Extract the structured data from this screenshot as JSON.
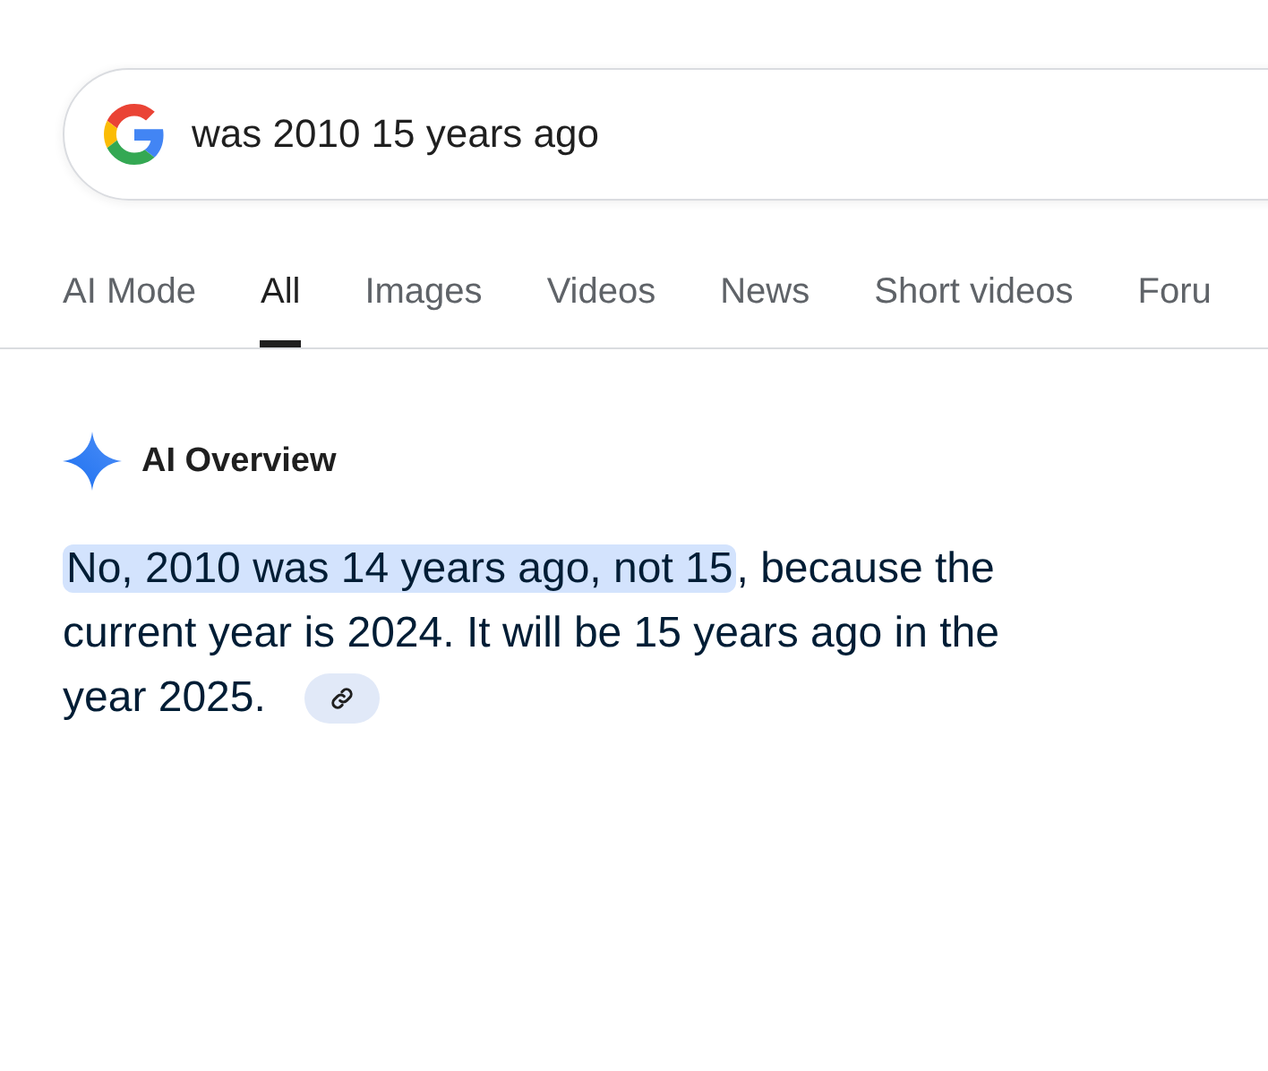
{
  "search": {
    "value": "was 2010 15 years ago"
  },
  "tabs": [
    {
      "label": "AI Mode",
      "selected": false
    },
    {
      "label": "All",
      "selected": true
    },
    {
      "label": "Images",
      "selected": false
    },
    {
      "label": "Videos",
      "selected": false
    },
    {
      "label": "News",
      "selected": false
    },
    {
      "label": "Short videos",
      "selected": false
    },
    {
      "label": "Foru",
      "selected": false
    }
  ],
  "overview": {
    "title": "AI Overview",
    "answer": {
      "highlighted": "No, 2010 was 14 years ago, not 15",
      "rest": ", because the current year is 2024. It will be 15 years ago in the year 2025."
    }
  }
}
